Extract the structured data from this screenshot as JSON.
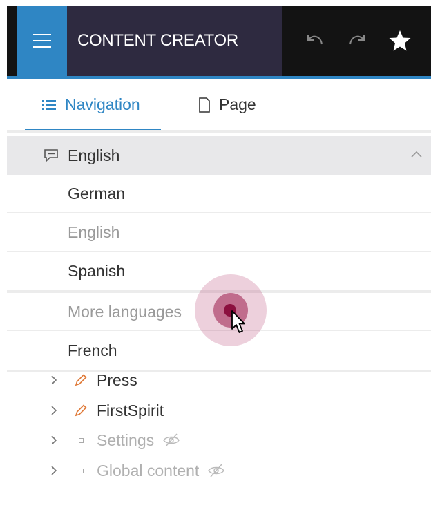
{
  "app": {
    "title": "CONTENT CREATOR"
  },
  "colors": {
    "accent": "#2f86c4",
    "topbar": "#131313",
    "title_bg": "#2e2a40",
    "click_ripple": "#8b0f3e"
  },
  "toolbar": {
    "icons": [
      "menu-icon",
      "undo-icon",
      "redo-icon",
      "star-icon"
    ]
  },
  "tabs": [
    {
      "label": "Navigation",
      "icon": "list-icon",
      "active": true
    },
    {
      "label": "Page",
      "icon": "page-icon",
      "active": false
    }
  ],
  "language": {
    "current": "English",
    "icon": "speech-bubble-icon",
    "options": [
      {
        "label": "German",
        "muted": false
      },
      {
        "label": "English",
        "muted": true
      },
      {
        "label": "Spanish",
        "muted": false
      },
      {
        "label": "More languages",
        "muted": true
      },
      {
        "label": "French",
        "muted": false
      }
    ]
  },
  "tree": [
    {
      "label": "Press",
      "icon": "pencil-icon",
      "hidden": false
    },
    {
      "label": "FirstSpirit",
      "icon": "pencil-icon",
      "hidden": false
    },
    {
      "label": "Settings",
      "icon": "square-icon",
      "hidden": true
    },
    {
      "label": "Global content",
      "icon": "square-icon",
      "hidden": true
    }
  ]
}
